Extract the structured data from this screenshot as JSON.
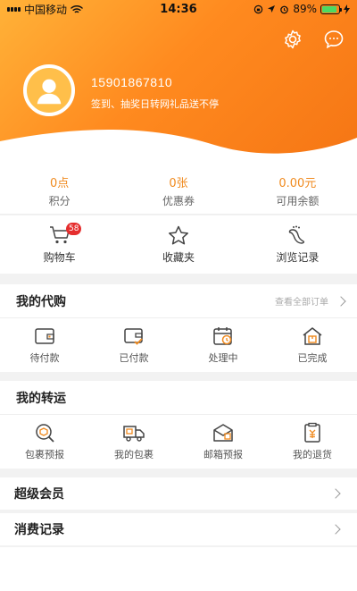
{
  "status_bar": {
    "carrier": "中国移动",
    "time": "14:36",
    "battery": "89%",
    "battery_level": 0.89
  },
  "profile": {
    "phone": "15901867810",
    "slogan": "签到、抽奖日转网礼品送不停"
  },
  "stats": [
    {
      "value": "0点",
      "label": "积分"
    },
    {
      "value": "0张",
      "label": "优惠券"
    },
    {
      "value": "0.00元",
      "label": "可用余额"
    }
  ],
  "quick": [
    {
      "label": "购物车",
      "icon": "cart-icon",
      "badge": "58"
    },
    {
      "label": "收藏夹",
      "icon": "star-icon"
    },
    {
      "label": "浏览记录",
      "icon": "footprint-icon"
    }
  ],
  "purchase": {
    "title": "我的代购",
    "link": "查看全部订单",
    "items": [
      {
        "label": "待付款",
        "icon": "wallet-icon"
      },
      {
        "label": "已付款",
        "icon": "wallet-check-icon"
      },
      {
        "label": "处理中",
        "icon": "calendar-clock-icon"
      },
      {
        "label": "已完成",
        "icon": "house-box-icon"
      }
    ]
  },
  "transfer": {
    "title": "我的转运",
    "items": [
      {
        "label": "包裹预报",
        "icon": "package-search-icon"
      },
      {
        "label": "我的包裹",
        "icon": "delivery-truck-icon"
      },
      {
        "label": "邮箱预报",
        "icon": "mailbox-icon"
      },
      {
        "label": "我的退货",
        "icon": "return-clipboard-icon"
      }
    ]
  },
  "rows": {
    "vip": "超级会员",
    "records": "消费记录"
  },
  "colors": {
    "accent": "#f08a1e",
    "badge": "#e52e2e",
    "header_start": "#ffb238",
    "header_end": "#f57514"
  }
}
